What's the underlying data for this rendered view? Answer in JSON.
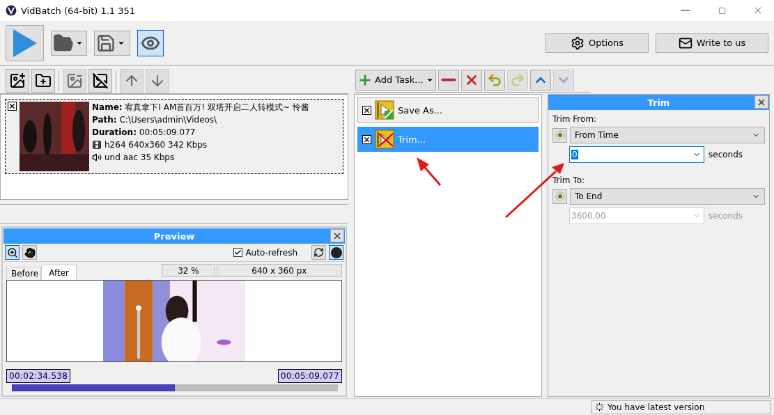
{
  "window": {
    "title": "VidBatch (64-bit) 1.1 351"
  },
  "toolbar": {
    "preview_on": true,
    "buttons": [
      {
        "kind": "options",
        "label": "Options"
      },
      {
        "kind": "mail",
        "label": "Write to us"
      }
    ]
  },
  "files": {
    "toolbar": [
      {
        "kind": "add-file",
        "disabled": false
      },
      {
        "kind": "add-folder",
        "disabled": false
      },
      {
        "kind": "remove",
        "disabled": true
      },
      {
        "kind": "clear",
        "disabled": false
      },
      {
        "kind": "up",
        "disabled": true
      },
      {
        "kind": "down",
        "disabled": true
      }
    ],
    "items": [
      {
        "checked": true,
        "name_label": "Name:",
        "name": "宥真拿下I AM首百万! 双塔开启二人转模式~ 怜酱",
        "path_label": "Path:",
        "path": "C:\\Users\\admin\\Videos\\",
        "duration_label": "Duration:",
        "duration": "00:05:09.077",
        "video": "h264 640x360 342 Kbps",
        "audio": "und aac 35 Kbps"
      }
    ]
  },
  "preview": {
    "title": "Preview",
    "auto_refresh_label": "Auto-refresh",
    "auto_refresh": true,
    "tabs": [
      {
        "label": "Before",
        "selected": false
      },
      {
        "label": "After",
        "selected": true
      }
    ],
    "zoom": "32 %",
    "size": "640 x 360 px",
    "start": "00:02:34.538",
    "end": "00:05:09.077",
    "level": 0.5
  },
  "tasks": {
    "add_label": "Add Task...",
    "toolbar": [
      {
        "kind": "remove",
        "disabled": false
      },
      {
        "kind": "delete",
        "disabled": false
      },
      {
        "kind": "undo",
        "disabled": false
      },
      {
        "kind": "redo",
        "disabled": true
      },
      {
        "kind": "up",
        "disabled": false
      },
      {
        "kind": "down",
        "disabled": true
      }
    ],
    "items": [
      {
        "kind": "save",
        "label": "Save As...",
        "checked": true,
        "selected": false
      },
      {
        "kind": "trim",
        "label": "Trim...",
        "checked": true,
        "selected": true
      }
    ]
  },
  "trim": {
    "title": "Trim",
    "from_label": "Trim From:",
    "from_mode": "From Time",
    "from_value": "0",
    "from_unit": "seconds",
    "to_label": "Trim To:",
    "to_mode": "To End",
    "to_value": "3600.00",
    "to_unit": "seconds",
    "to_disabled": true
  },
  "status": "You have latest version"
}
